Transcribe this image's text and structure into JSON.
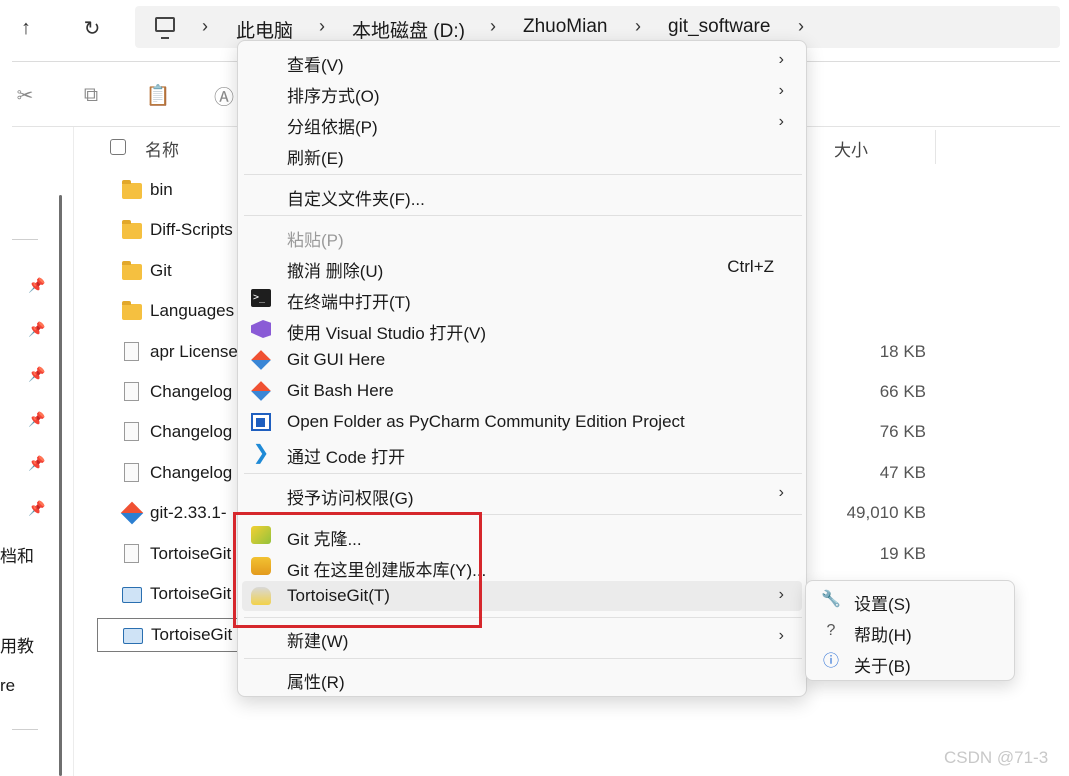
{
  "breadcrumb": [
    "此电脑",
    "本地磁盘 (D:)",
    "ZhuoMian",
    "git_software"
  ],
  "breadcrumb_separator": ">",
  "nav": {
    "up_icon": "↑",
    "refresh_icon": "↻"
  },
  "toolbar": {
    "cut_icon": "✂",
    "copy_icon": "⧉",
    "paste_icon": "📋",
    "rename_icon": "Ⓐ"
  },
  "sidebar": {
    "pin_icon": "📌",
    "partial_labels": [
      "档和",
      "用教",
      "re"
    ]
  },
  "columns": {
    "name": "名称",
    "size": "大小"
  },
  "files": [
    {
      "name": "bin",
      "type": "folder",
      "size": ""
    },
    {
      "name": "Diff-Scripts",
      "type": "folder",
      "size": ""
    },
    {
      "name": "Git",
      "type": "folder",
      "size": ""
    },
    {
      "name": "Languages",
      "type": "folder",
      "size": ""
    },
    {
      "name": "apr License",
      "type": "doc",
      "size": "18 KB"
    },
    {
      "name": "Changelog",
      "type": "doc",
      "size": "66 KB"
    },
    {
      "name": "Changelog",
      "type": "doc",
      "size": "76 KB"
    },
    {
      "name": "Changelog",
      "type": "doc",
      "size": "47 KB"
    },
    {
      "name": "git-2.33.1-",
      "type": "git",
      "size": "49,010 KB"
    },
    {
      "name": "TortoiseGit",
      "type": "doc",
      "size": "19 KB"
    },
    {
      "name": "TortoiseGit",
      "type": "exe",
      "size": ""
    },
    {
      "name": "TortoiseGit",
      "type": "exe",
      "size": ""
    }
  ],
  "context_menu": {
    "view": "查看(V)",
    "sort": "排序方式(O)",
    "group": "分组依据(P)",
    "refresh": "刷新(E)",
    "customize": "自定义文件夹(F)...",
    "paste": "粘贴(P)",
    "undo": "撤消 删除(U)",
    "undo_shortcut": "Ctrl+Z",
    "terminal": "在终端中打开(T)",
    "visual_studio": "使用 Visual Studio 打开(V)",
    "git_gui": "Git GUI Here",
    "git_bash": "Git Bash Here",
    "pycharm": "Open Folder as PyCharm Community Edition Project",
    "vscode": "通过 Code 打开",
    "grant_access": "授予访问权限(G)",
    "git_clone": "Git 克隆...",
    "git_create_repo": "Git 在这里创建版本库(Y)...",
    "tortoisegit": "TortoiseGit(T)",
    "new": "新建(W)",
    "properties": "属性(R)",
    "submenu_arrow": "›"
  },
  "submenu": {
    "settings": "设置(S)",
    "help": "帮助(H)",
    "about": "关于(B)",
    "settings_icon": "🔧",
    "help_icon": "?",
    "about_icon": "ⓘ"
  },
  "watermark": "CSDN @71-3",
  "colors": {
    "highlight_border": "#d6272c",
    "menu_bg": "#f9f9f9"
  }
}
